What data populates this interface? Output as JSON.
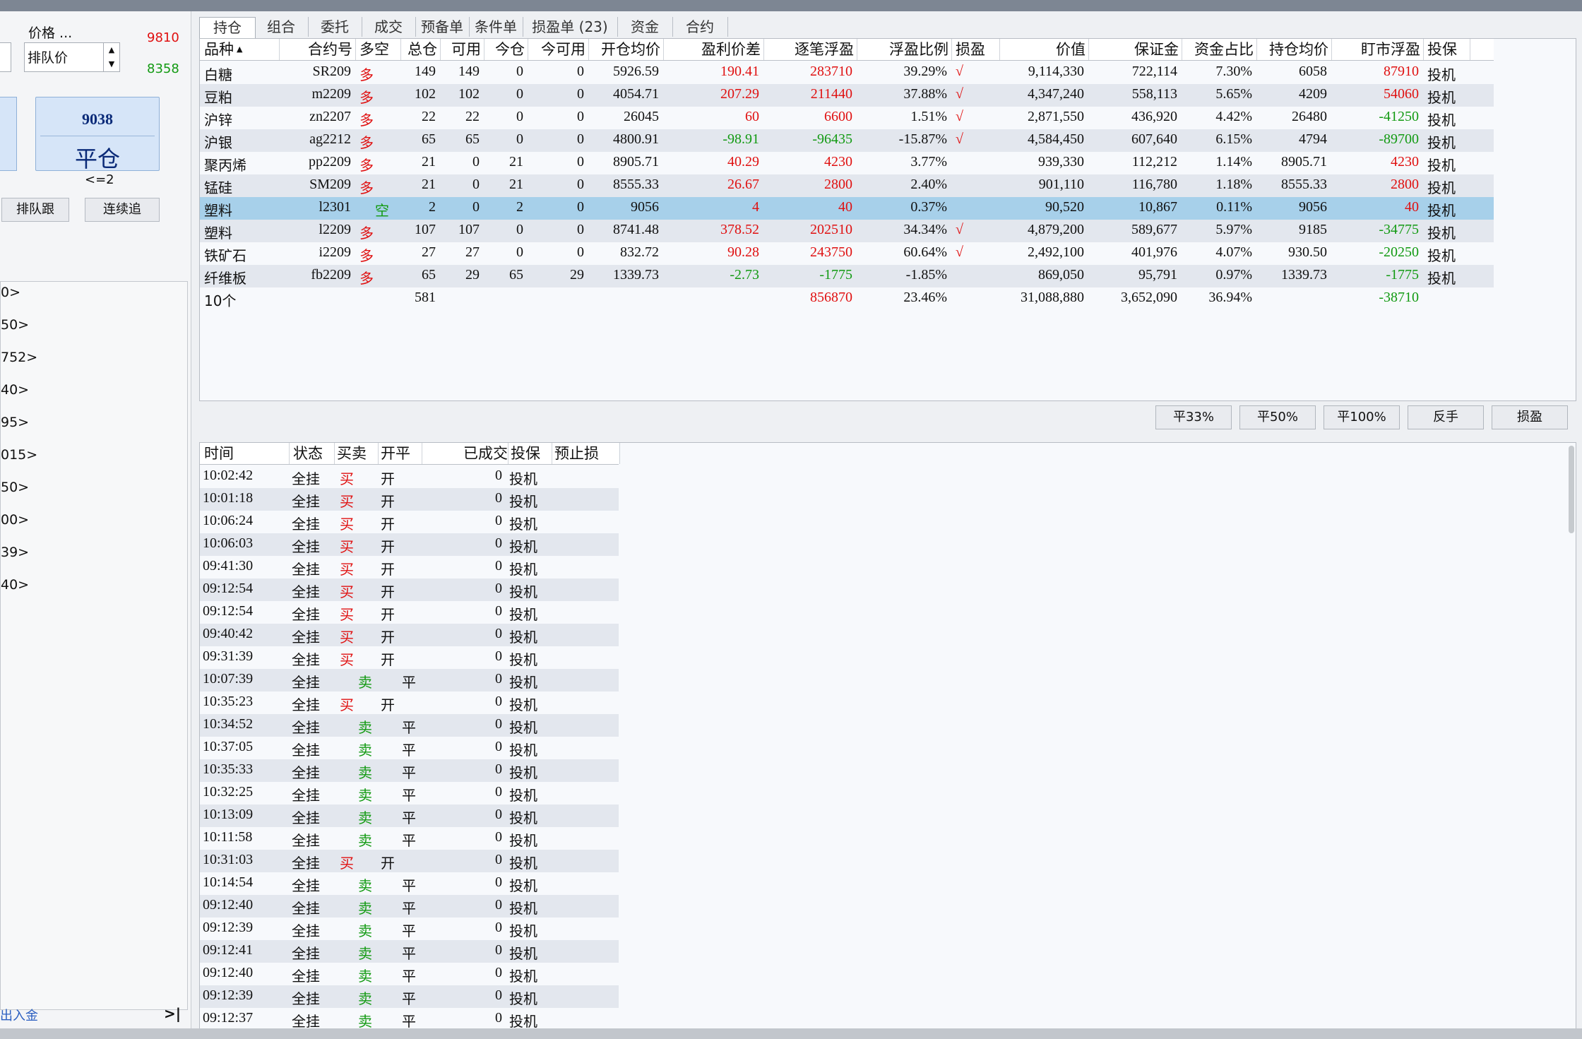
{
  "left_panel": {
    "price_label": "价格 ...",
    "upper_limit": "9810",
    "lower_limit": "8358",
    "price_type": "排队价",
    "close_price": "9038",
    "close_button": "平仓",
    "condition": "<=2",
    "queue_follow": "排队跟",
    "continuous_chase": "连续追",
    "list_items": [
      "0>",
      "50>",
      "752>",
      "40>",
      "95>",
      "015>",
      "50>",
      "00>",
      "39>",
      "40>"
    ],
    "footer_link": "出入金",
    "footer_icon": "collapse-icon",
    "footer_glyph": ">|"
  },
  "tabs": [
    "持仓",
    "组合",
    "委托",
    "成交",
    "预备单",
    "条件单",
    "损盈单 (23)",
    "资金",
    "合约"
  ],
  "positions": {
    "columns": [
      "品种",
      "合约号",
      "多空",
      "总仓",
      "可用",
      "今仓",
      "今可用",
      "开仓均价",
      "盈利价差",
      "逐笔浮盈",
      "浮盈比例",
      "损盈",
      "价值",
      "保证金",
      "资金占比",
      "持仓均价",
      "盯市浮盈",
      "投保"
    ],
    "sort_indicator": "▲",
    "rows": [
      {
        "name": "白糖",
        "code": "SR209",
        "dir": "多",
        "total": "149",
        "avail": "149",
        "today": "0",
        "today_avail": "0",
        "open_avg": "5926.59",
        "diff": "190.41",
        "float": "283710",
        "ratio": "39.29%",
        "sl": "√",
        "value": "9,114,330",
        "margin": "722,114",
        "share": "7.30%",
        "hold_avg": "6058",
        "mtm": "87910",
        "hedge": "投机"
      },
      {
        "name": "豆粕",
        "code": "m2209",
        "dir": "多",
        "total": "102",
        "avail": "102",
        "today": "0",
        "today_avail": "0",
        "open_avg": "4054.71",
        "diff": "207.29",
        "float": "211440",
        "ratio": "37.88%",
        "sl": "√",
        "value": "4,347,240",
        "margin": "558,113",
        "share": "5.65%",
        "hold_avg": "4209",
        "mtm": "54060",
        "hedge": "投机"
      },
      {
        "name": "沪锌",
        "code": "zn2207",
        "dir": "多",
        "total": "22",
        "avail": "22",
        "today": "0",
        "today_avail": "0",
        "open_avg": "26045",
        "diff": "60",
        "float": "6600",
        "ratio": "1.51%",
        "sl": "√",
        "value": "2,871,550",
        "margin": "436,920",
        "share": "4.42%",
        "hold_avg": "26480",
        "mtm": "-41250",
        "hedge": "投机"
      },
      {
        "name": "沪银",
        "code": "ag2212",
        "dir": "多",
        "total": "65",
        "avail": "65",
        "today": "0",
        "today_avail": "0",
        "open_avg": "4800.91",
        "diff": "-98.91",
        "float": "-96435",
        "ratio": "-15.87%",
        "sl": "√",
        "value": "4,584,450",
        "margin": "607,640",
        "share": "6.15%",
        "hold_avg": "4794",
        "mtm": "-89700",
        "hedge": "投机"
      },
      {
        "name": "聚丙烯",
        "code": "pp2209",
        "dir": "多",
        "total": "21",
        "avail": "0",
        "today": "21",
        "today_avail": "0",
        "open_avg": "8905.71",
        "diff": "40.29",
        "float": "4230",
        "ratio": "3.77%",
        "sl": "",
        "value": "939,330",
        "margin": "112,212",
        "share": "1.14%",
        "hold_avg": "8905.71",
        "mtm": "4230",
        "hedge": "投机"
      },
      {
        "name": "锰硅",
        "code": "SM209",
        "dir": "多",
        "total": "21",
        "avail": "0",
        "today": "21",
        "today_avail": "0",
        "open_avg": "8555.33",
        "diff": "26.67",
        "float": "2800",
        "ratio": "2.40%",
        "sl": "",
        "value": "901,110",
        "margin": "116,780",
        "share": "1.18%",
        "hold_avg": "8555.33",
        "mtm": "2800",
        "hedge": "投机"
      },
      {
        "name": "塑料",
        "code": "l2301",
        "dir": "空",
        "total": "2",
        "avail": "0",
        "today": "2",
        "today_avail": "0",
        "open_avg": "9056",
        "diff": "4",
        "float": "40",
        "ratio": "0.37%",
        "sl": "",
        "value": "90,520",
        "margin": "10,867",
        "share": "0.11%",
        "hold_avg": "9056",
        "mtm": "40",
        "hedge": "投机"
      },
      {
        "name": "塑料",
        "code": "l2209",
        "dir": "多",
        "total": "107",
        "avail": "107",
        "today": "0",
        "today_avail": "0",
        "open_avg": "8741.48",
        "diff": "378.52",
        "float": "202510",
        "ratio": "34.34%",
        "sl": "√",
        "value": "4,879,200",
        "margin": "589,677",
        "share": "5.97%",
        "hold_avg": "9185",
        "mtm": "-34775",
        "hedge": "投机"
      },
      {
        "name": "铁矿石",
        "code": "i2209",
        "dir": "多",
        "total": "27",
        "avail": "27",
        "today": "0",
        "today_avail": "0",
        "open_avg": "832.72",
        "diff": "90.28",
        "float": "243750",
        "ratio": "60.64%",
        "sl": "√",
        "value": "2,492,100",
        "margin": "401,976",
        "share": "4.07%",
        "hold_avg": "930.50",
        "mtm": "-20250",
        "hedge": "投机"
      },
      {
        "name": "纤维板",
        "code": "fb2209",
        "dir": "多",
        "total": "65",
        "avail": "29",
        "today": "65",
        "today_avail": "29",
        "open_avg": "1339.73",
        "diff": "-2.73",
        "float": "-1775",
        "ratio": "-1.85%",
        "sl": "",
        "value": "869,050",
        "margin": "95,791",
        "share": "0.97%",
        "hold_avg": "1339.73",
        "mtm": "-1775",
        "hedge": "投机"
      }
    ],
    "summary": {
      "name": "10个",
      "total": "581",
      "float": "856870",
      "ratio": "23.46%",
      "value": "31,088,880",
      "margin": "3,652,090",
      "share": "36.94%",
      "mtm": "-38710"
    }
  },
  "actions": [
    "平33%",
    "平50%",
    "平100%",
    "反手",
    "损盈"
  ],
  "orders": {
    "columns": [
      "时间",
      "状态",
      "买卖",
      "开平",
      "已成交",
      "投保",
      "预止损"
    ],
    "rows": [
      {
        "time": "10:02:42",
        "status": "全挂",
        "side": "买",
        "oc": "开",
        "filled": "0",
        "hedge": "投机"
      },
      {
        "time": "10:01:18",
        "status": "全挂",
        "side": "买",
        "oc": "开",
        "filled": "0",
        "hedge": "投机"
      },
      {
        "time": "10:06:24",
        "status": "全挂",
        "side": "买",
        "oc": "开",
        "filled": "0",
        "hedge": "投机"
      },
      {
        "time": "10:06:03",
        "status": "全挂",
        "side": "买",
        "oc": "开",
        "filled": "0",
        "hedge": "投机"
      },
      {
        "time": "09:41:30",
        "status": "全挂",
        "side": "买",
        "oc": "开",
        "filled": "0",
        "hedge": "投机"
      },
      {
        "time": "09:12:54",
        "status": "全挂",
        "side": "买",
        "oc": "开",
        "filled": "0",
        "hedge": "投机"
      },
      {
        "time": "09:12:54",
        "status": "全挂",
        "side": "买",
        "oc": "开",
        "filled": "0",
        "hedge": "投机"
      },
      {
        "time": "09:40:42",
        "status": "全挂",
        "side": "买",
        "oc": "开",
        "filled": "0",
        "hedge": "投机"
      },
      {
        "time": "09:31:39",
        "status": "全挂",
        "side": "买",
        "oc": "开",
        "filled": "0",
        "hedge": "投机"
      },
      {
        "time": "10:07:39",
        "status": "全挂",
        "side": "卖",
        "oc": "平",
        "filled": "0",
        "hedge": "投机"
      },
      {
        "time": "10:35:23",
        "status": "全挂",
        "side": "买",
        "oc": "开",
        "filled": "0",
        "hedge": "投机"
      },
      {
        "time": "10:34:52",
        "status": "全挂",
        "side": "卖",
        "oc": "平",
        "filled": "0",
        "hedge": "投机"
      },
      {
        "time": "10:37:05",
        "status": "全挂",
        "side": "卖",
        "oc": "平",
        "filled": "0",
        "hedge": "投机"
      },
      {
        "time": "10:35:33",
        "status": "全挂",
        "side": "卖",
        "oc": "平",
        "filled": "0",
        "hedge": "投机"
      },
      {
        "time": "10:32:25",
        "status": "全挂",
        "side": "卖",
        "oc": "平",
        "filled": "0",
        "hedge": "投机"
      },
      {
        "time": "10:13:09",
        "status": "全挂",
        "side": "卖",
        "oc": "平",
        "filled": "0",
        "hedge": "投机"
      },
      {
        "time": "10:11:58",
        "status": "全挂",
        "side": "卖",
        "oc": "平",
        "filled": "0",
        "hedge": "投机"
      },
      {
        "time": "10:31:03",
        "status": "全挂",
        "side": "买",
        "oc": "开",
        "filled": "0",
        "hedge": "投机"
      },
      {
        "time": "10:14:54",
        "status": "全挂",
        "side": "卖",
        "oc": "平",
        "filled": "0",
        "hedge": "投机"
      },
      {
        "time": "09:12:40",
        "status": "全挂",
        "side": "卖",
        "oc": "平",
        "filled": "0",
        "hedge": "投机"
      },
      {
        "time": "09:12:39",
        "status": "全挂",
        "side": "卖",
        "oc": "平",
        "filled": "0",
        "hedge": "投机"
      },
      {
        "time": "09:12:41",
        "status": "全挂",
        "side": "卖",
        "oc": "平",
        "filled": "0",
        "hedge": "投机"
      },
      {
        "time": "09:12:40",
        "status": "全挂",
        "side": "卖",
        "oc": "平",
        "filled": "0",
        "hedge": "投机"
      },
      {
        "time": "09:12:39",
        "status": "全挂",
        "side": "卖",
        "oc": "平",
        "filled": "0",
        "hedge": "投机"
      },
      {
        "time": "09:12:37",
        "status": "全挂",
        "side": "卖",
        "oc": "平",
        "filled": "0",
        "hedge": "投机"
      }
    ]
  },
  "colors": {
    "profit": "#e01010",
    "loss": "#129a12",
    "selected_row": "#a7d0ea",
    "alt_row": "#e3e7ee"
  }
}
